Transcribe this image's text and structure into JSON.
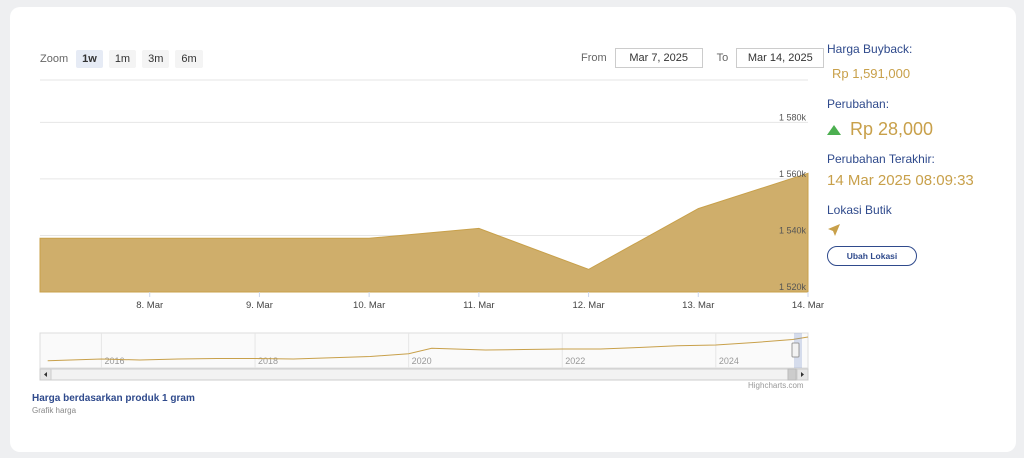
{
  "zoom": {
    "label": "Zoom",
    "buttons": [
      "1w",
      "1m",
      "3m",
      "6m"
    ],
    "active": "1w"
  },
  "range": {
    "from_label": "From",
    "from_value": "Mar 7, 2025",
    "to_label": "To",
    "to_value": "Mar 14, 2025"
  },
  "side": {
    "buyback_label": "Harga Buyback:",
    "buyback_value": "Rp 1,591,000",
    "change_label": "Perubahan:",
    "change_value": "Rp 28,000",
    "last_change_label": "Perubahan Terakhir:",
    "last_change_value": "14 Mar 2025 08:09:33",
    "location_label": "Lokasi Butik",
    "location_button": "Ubah Lokasi",
    "up_icon": "triangle-up-icon",
    "pin_icon": "location-arrow-icon"
  },
  "caption": {
    "title": "Harga berdasarkan produk 1 gram",
    "subtitle": "Grafik harga"
  },
  "credits": "Highcharts.com",
  "colors": {
    "area_fill": "#cfae6b",
    "area_line": "#c8a04a",
    "brand_blue": "#2f4a8c",
    "up_green": "#4caf50"
  },
  "chart_data": [
    {
      "type": "area",
      "x": [
        "2025-03-07",
        "2025-03-08",
        "2025-03-09",
        "2025-03-10",
        "2025-03-11",
        "2025-03-12",
        "2025-03-13",
        "2025-03-14"
      ],
      "y": [
        1539000,
        1539000,
        1539000,
        1539000,
        1542500,
        1528000,
        1549500,
        1562000
      ],
      "x_ticks": [
        "8. Mar",
        "9. Mar",
        "10. Mar",
        "11. Mar",
        "12. Mar",
        "13. Mar",
        "14. Mar"
      ],
      "y_ticks": [
        "1 520k",
        "1 540k",
        "1 560k",
        "1 580k"
      ],
      "ylim": [
        1520000,
        1595000
      ],
      "grid": true,
      "title": "",
      "xlabel": "",
      "ylabel": ""
    },
    {
      "type": "line",
      "role": "navigator",
      "x_ticks": [
        "2016",
        "2018",
        "2020",
        "2022",
        "2024"
      ],
      "x": [
        2015.3,
        2016,
        2016.5,
        2017,
        2017.5,
        2018,
        2018.5,
        2019,
        2019.5,
        2020,
        2020.3,
        2020.6,
        2021,
        2021.5,
        2022,
        2022.5,
        2023,
        2023.5,
        2024,
        2024.5,
        2025,
        2025.2
      ],
      "y": [
        0.05,
        0.12,
        0.08,
        0.12,
        0.14,
        0.14,
        0.12,
        0.17,
        0.22,
        0.33,
        0.55,
        0.52,
        0.48,
        0.5,
        0.52,
        0.52,
        0.58,
        0.65,
        0.68,
        0.78,
        0.9,
        1.0
      ],
      "xlim": [
        2015.2,
        2025.2
      ]
    }
  ]
}
